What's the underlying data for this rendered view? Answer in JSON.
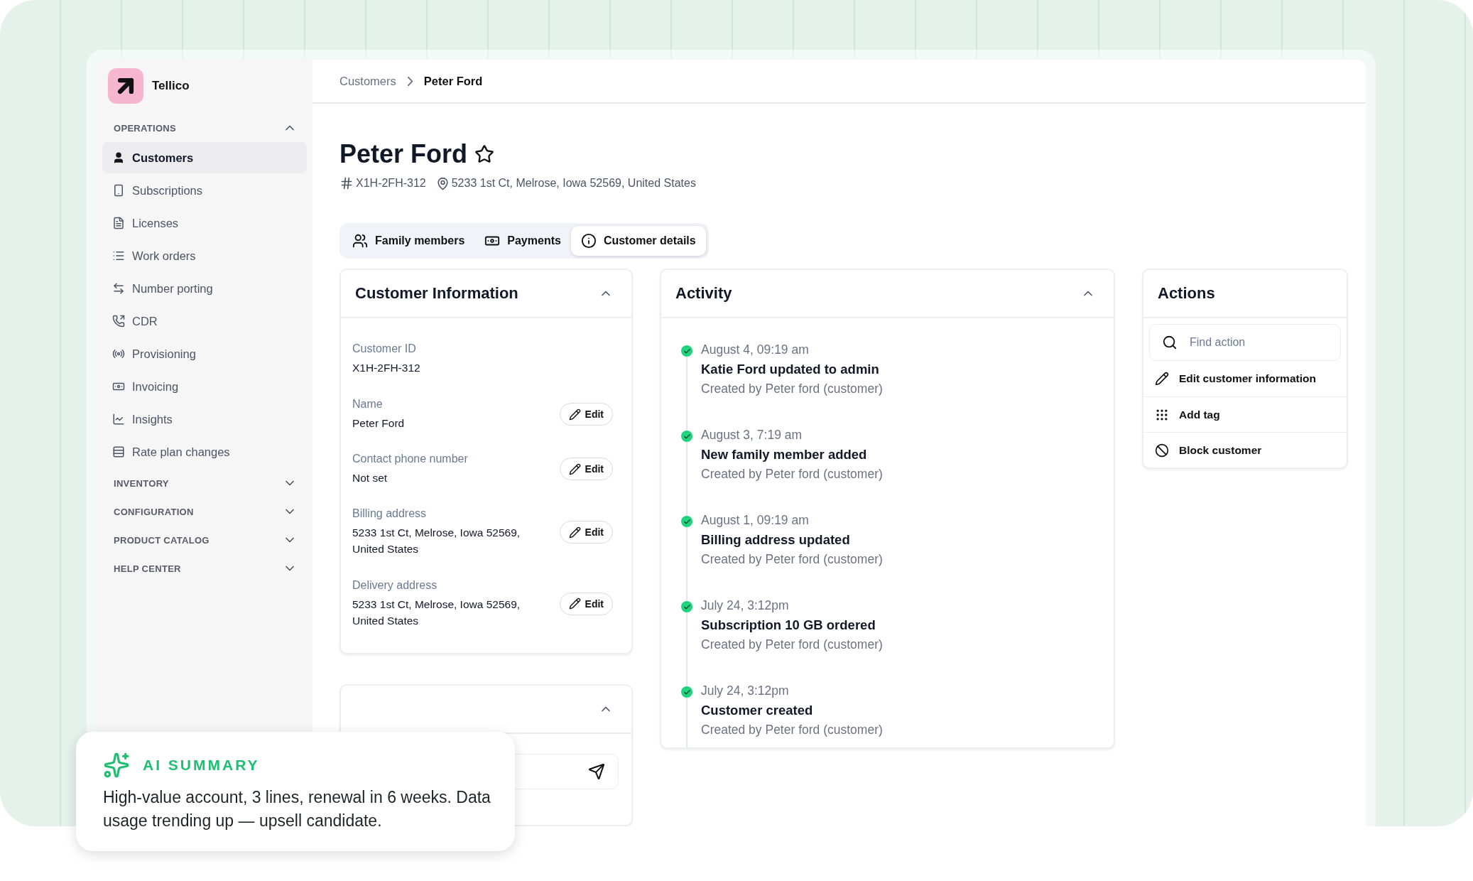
{
  "brand": {
    "name": "Tellico"
  },
  "sidebar": {
    "sections": [
      {
        "title": "OPERATIONS",
        "expanded": true,
        "items": [
          {
            "label": "Customers",
            "selected": true
          },
          {
            "label": "Subscriptions",
            "selected": false
          },
          {
            "label": "Licenses",
            "selected": false
          },
          {
            "label": "Work orders",
            "selected": false
          },
          {
            "label": "Number porting",
            "selected": false
          },
          {
            "label": "CDR",
            "selected": false
          },
          {
            "label": "Provisioning",
            "selected": false
          },
          {
            "label": "Invoicing",
            "selected": false
          },
          {
            "label": "Insights",
            "selected": false
          },
          {
            "label": "Rate plan changes",
            "selected": false
          }
        ]
      },
      {
        "title": "INVENTORY",
        "expanded": false
      },
      {
        "title": "CONFIGURATION",
        "expanded": false
      },
      {
        "title": "PRODUCT CATALOG",
        "expanded": false
      },
      {
        "title": "HELP CENTER",
        "expanded": false
      }
    ]
  },
  "breadcrumb": [
    {
      "label": "Customers",
      "current": false
    },
    {
      "label": "Peter Ford",
      "current": true
    }
  ],
  "customer": {
    "name": "Peter Ford",
    "favorite": false,
    "id": "X1H-2FH-312",
    "address": "5233 1st Ct, Melrose, Iowa 52569, United States"
  },
  "tabs": [
    {
      "label": "Family members",
      "selected": false
    },
    {
      "label": "Payments",
      "selected": false
    },
    {
      "label": "Customer details",
      "selected": true
    }
  ],
  "customer_information": {
    "title": "Customer Information",
    "expanded": true,
    "fields": [
      {
        "label": "Customer ID",
        "value": "X1H-2FH-312",
        "editable": false
      },
      {
        "label": "Name",
        "value": "Peter Ford",
        "editable": true,
        "action": "Edit"
      },
      {
        "label": "Contact phone number",
        "value": "Not set",
        "editable": true,
        "action": "Edit"
      },
      {
        "label": "Billing address",
        "value": "5233 1st Ct, Melrose, Iowa 52569, United States",
        "editable": true,
        "action": "Edit"
      },
      {
        "label": "Delivery address",
        "value": "5233 1st Ct, Melrose, Iowa 52569, United States",
        "editable": true,
        "action": "Edit"
      }
    ]
  },
  "second_panel": {
    "expanded": true
  },
  "activity": {
    "title": "Activity",
    "expanded": true,
    "events": [
      {
        "time": "August 4, 09:19 am",
        "title": "Katie Ford updated to admin",
        "by": "Created by Peter ford (customer)",
        "done": true
      },
      {
        "time": "August 3, 7:19 am",
        "title": "New family member added",
        "by": "Created by Peter ford (customer)",
        "done": true
      },
      {
        "time": "August 1, 09:19 am",
        "title": "Billing address updated",
        "by": "Created by Peter ford (customer)",
        "done": true
      },
      {
        "time": "July 24, 3:12pm",
        "title": "Subscription 10 GB ordered",
        "by": "Created by Peter ford (customer)",
        "done": true
      },
      {
        "time": "July 24, 3:12pm",
        "title": "Customer created",
        "by": "Created by Peter ford (customer)",
        "done": true
      }
    ]
  },
  "actions": {
    "title": "Actions",
    "search": {
      "placeholder": "Find action"
    },
    "items": [
      {
        "label": "Edit customer information"
      },
      {
        "label": "Add tag"
      },
      {
        "label": "Block customer"
      }
    ]
  },
  "ai_summary": {
    "title": "AI SUMMARY",
    "text": "High-value account, 3 lines, renewal in 6 weeks. Data usage trending up — upsell candidate."
  }
}
